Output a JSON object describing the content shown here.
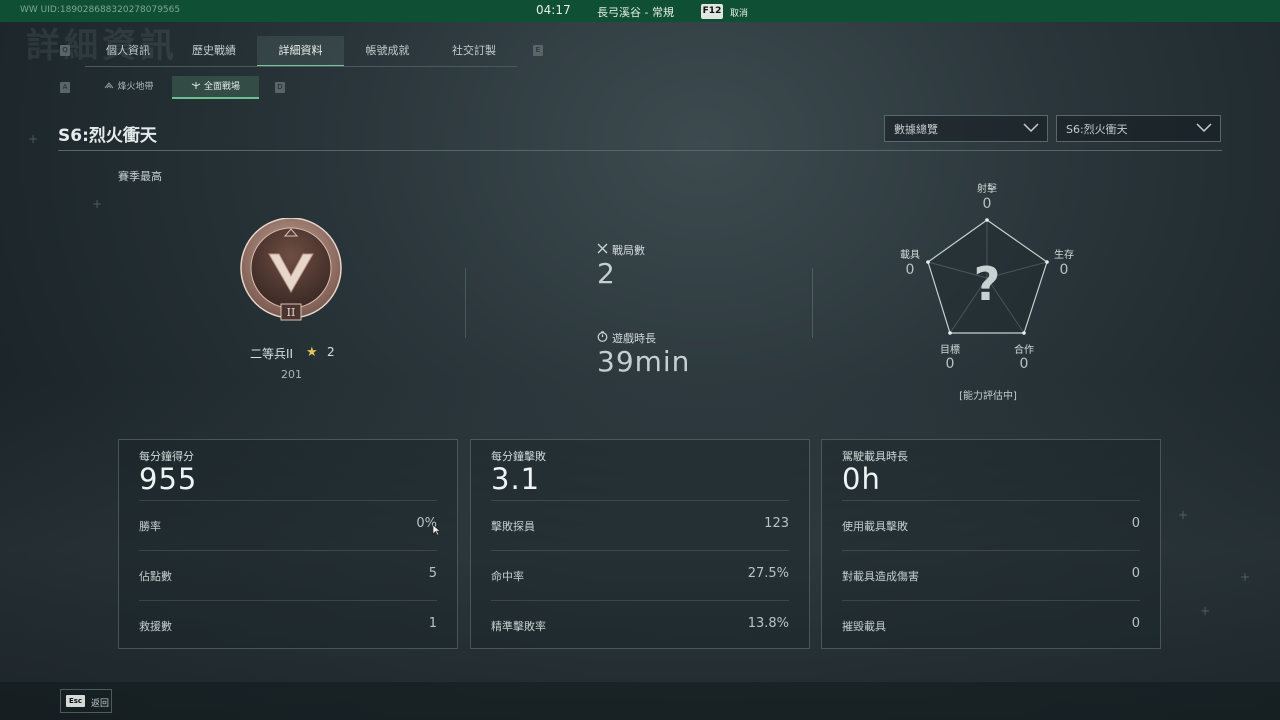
{
  "topbar": {
    "uid": "WW UID:1890286883202780795​65",
    "time": "04:17",
    "map": "長弓溪谷 - 常規",
    "cancel_key": "F12",
    "cancel_label": "取消"
  },
  "background_title": "詳細資訊",
  "tabs": {
    "prev_key": "Q",
    "next_key": "E",
    "items": [
      {
        "label": "個人資訊"
      },
      {
        "label": "歷史戰績"
      },
      {
        "label": "詳細資料"
      },
      {
        "label": "帳號成就"
      },
      {
        "label": "社交訂製"
      }
    ],
    "active_index": 2
  },
  "subtabs": {
    "prev_key": "A",
    "next_key": "D",
    "items": [
      {
        "label": "烽火地帶"
      },
      {
        "label": "全面戰場"
      }
    ],
    "active_index": 1
  },
  "season": {
    "title": "S6:烈火衝天",
    "dropdown_view": "數據總覽",
    "dropdown_season": "S6:烈火衝天"
  },
  "season_high_label": "賽季最高",
  "rank": {
    "name": "二等兵II",
    "stars": "2",
    "points": "201",
    "roman": "II"
  },
  "summary": {
    "matches_label": "戰局數",
    "matches_value": "2",
    "playtime_label": "遊戲時長",
    "playtime_value": "39min"
  },
  "radar": {
    "shooting_label": "射擊",
    "shooting_value": "0",
    "survival_label": "生存",
    "survival_value": "0",
    "coop_label": "合作",
    "coop_value": "0",
    "objective_label": "目標",
    "objective_value": "0",
    "vehicle_label": "載具",
    "vehicle_value": "0",
    "status": "[能力評估中]",
    "placeholder": "?"
  },
  "cards": [
    {
      "title": "每分鐘得分",
      "value": "955",
      "rows": [
        {
          "label": "勝率",
          "value": "0%"
        },
        {
          "label": "佔點數",
          "value": "5"
        },
        {
          "label": "救援數",
          "value": "1"
        }
      ]
    },
    {
      "title": "每分鐘擊敗",
      "value": "3.1",
      "rows": [
        {
          "label": "擊敗探員",
          "value": "123"
        },
        {
          "label": "命中率",
          "value": "27.5%"
        },
        {
          "label": "精準擊敗率",
          "value": "13.8%"
        }
      ]
    },
    {
      "title": "駕駛載具時長",
      "value": "0h",
      "rows": [
        {
          "label": "使用載具擊敗",
          "value": "0"
        },
        {
          "label": "對載具造成傷害",
          "value": "0"
        },
        {
          "label": "摧毀載具",
          "value": "0"
        }
      ]
    }
  ],
  "footer": {
    "back_key": "Esc",
    "back_label": "返回"
  },
  "colors": {
    "topbar": "#0f4f33",
    "accent": "#7cc49b",
    "star": "#e6c85a"
  }
}
